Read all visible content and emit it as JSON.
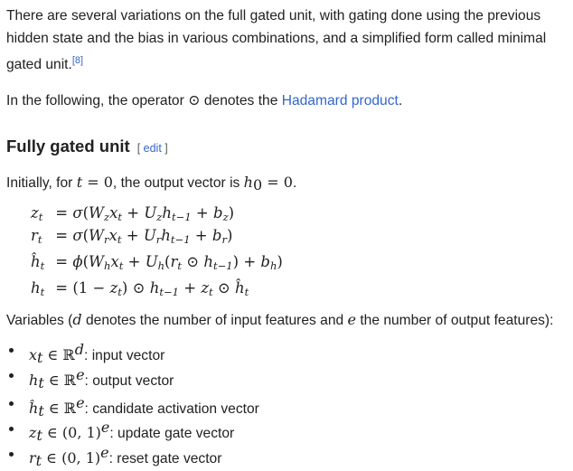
{
  "intro": {
    "line1": "There are several variations on the full gated unit, with gating done using the previous",
    "line2": "hidden state and the bias in various combinations, and a simplified form called minimal",
    "line3": "gated unit.",
    "ref": "[8]"
  },
  "operator_sentence": {
    "before": "In the following, the operator ",
    "symbol": "⊙",
    "middle": " denotes the ",
    "link": "Hadamard product",
    "after": "."
  },
  "section": {
    "title": "Fully gated unit",
    "edit_open": "[ ",
    "edit_label": "edit",
    "edit_close": " ]"
  },
  "initial": {
    "before": "Initially, for ",
    "t": "t",
    "eq1": " = 0",
    "middle": ", the output vector is ",
    "h": "h",
    "h_sub": "0",
    "eq2": " = 0",
    "after": "."
  },
  "equations": [
    {
      "lhs": "z",
      "sub": "t",
      "rhs": "= σ(W_z x_t + U_z h_{t−1} + b_z)"
    },
    {
      "lhs": "r",
      "sub": "t",
      "rhs": "= σ(W_r x_t + U_r h_{t−1} + b_r)"
    },
    {
      "lhs": "ĥ",
      "sub": "t",
      "rhs": "= ϕ(W_h x_t + U_h(r_t ⊙ h_{t−1}) + b_h)"
    },
    {
      "lhs": "h",
      "sub": "t",
      "rhs": "= (1 − z_t) ⊙ h_{t−1} + z_t ⊙ ĥ_t"
    }
  ],
  "variables": {
    "before": "Variables (",
    "d": "d",
    "middle": " denotes the number of input features and ",
    "e": "e",
    "after": " the number of output features):"
  },
  "list": [
    {
      "sym": "x",
      "sub": "t",
      "set": " ∈ ℝ",
      "sup": "d",
      "desc": ": input vector"
    },
    {
      "sym": "h",
      "sub": "t",
      "set": " ∈ ℝ",
      "sup": "e",
      "desc": ": output vector"
    },
    {
      "sym": "ĥ",
      "sub": "t",
      "set": " ∈ ℝ",
      "sup": "e",
      "desc": ": candidate activation vector"
    },
    {
      "sym": "z",
      "sub": "t",
      "set": " ∈ (0, 1)",
      "sup": "e",
      "desc": ": update gate vector"
    },
    {
      "sym": "r",
      "sub": "t",
      "set": " ∈ (0, 1)",
      "sup": "e",
      "desc": ": reset gate vector"
    }
  ]
}
